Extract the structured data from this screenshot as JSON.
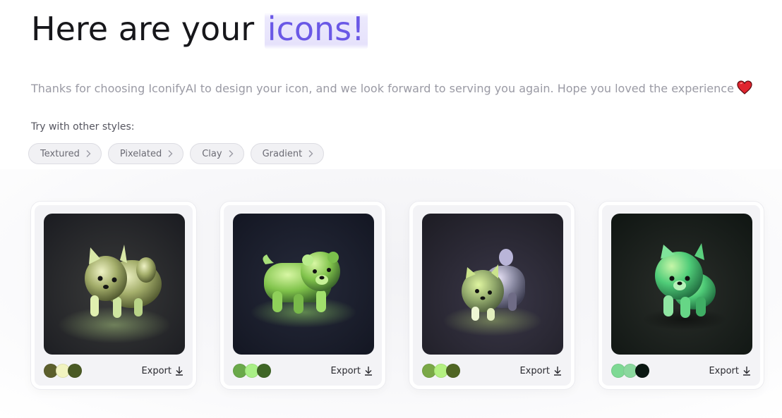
{
  "header": {
    "title_prefix": "Here are your ",
    "title_highlight": "icons!",
    "subtitle": "Thanks for choosing IconifyAI to design your icon, and we look forward to serving you again. Hope you loved the experience"
  },
  "styles_section": {
    "label": "Try with other styles:",
    "chips": [
      "Textured",
      "Pixelated",
      "Clay",
      "Gradient"
    ]
  },
  "cards": [
    {
      "export_label": "Export",
      "palette": [
        "#5c5f2c",
        "#f1f3bf",
        "#4a5a24"
      ],
      "bg": "#2a2b30"
    },
    {
      "export_label": "Export",
      "palette": [
        "#6aa94a",
        "#a9ef86",
        "#3f6626"
      ],
      "bg": "#1a1d2a"
    },
    {
      "export_label": "Export",
      "palette": [
        "#7aa847",
        "#b4f081",
        "#506624"
      ],
      "bg": "#252430"
    },
    {
      "export_label": "Export",
      "palette": [
        "#7ed994",
        "#8bd89e",
        "#0b1712"
      ],
      "bg": "#141a18"
    }
  ],
  "colors": {
    "accent": "#6a58e6",
    "highlight_bg": "#ece9fd",
    "heart": "#e0242e"
  },
  "icons": [
    "heart-icon",
    "chevron-right-icon",
    "download-icon"
  ]
}
